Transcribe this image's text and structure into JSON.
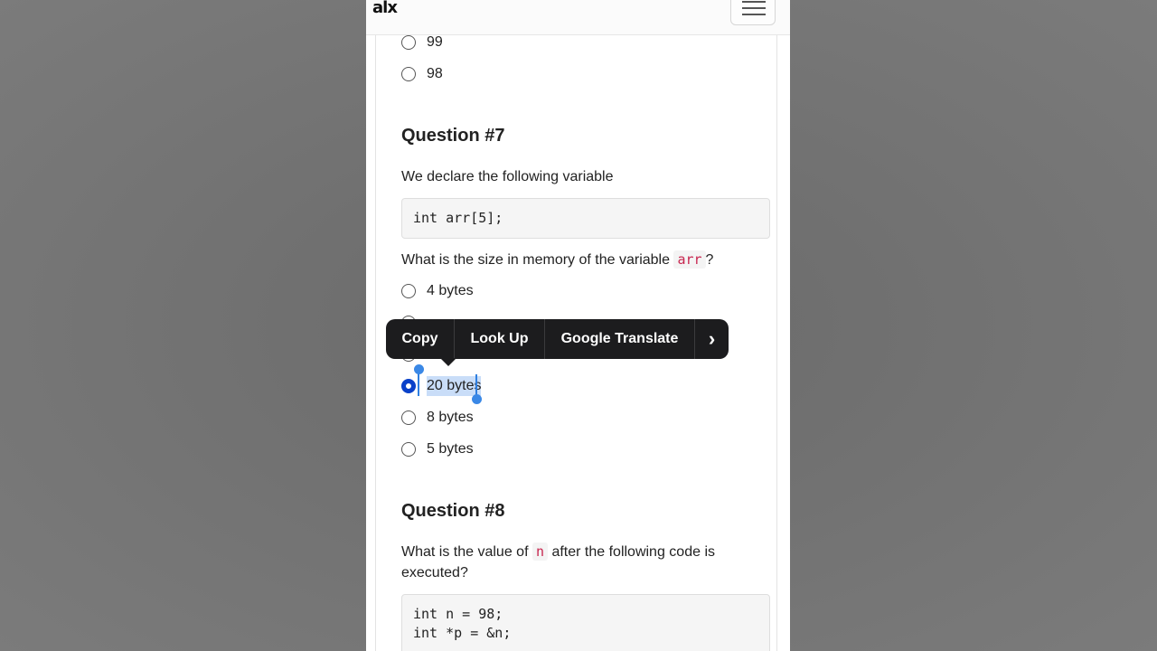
{
  "header": {
    "logo": "alx"
  },
  "prev_options": [
    {
      "label": "99"
    },
    {
      "label": "98"
    }
  ],
  "q7": {
    "title": "Question #7",
    "intro": "We declare the following variable",
    "code": "int arr[5];",
    "prompt_before": "What is the size in memory of the variable ",
    "prompt_code": "arr",
    "prompt_after": "?",
    "options": [
      {
        "label": "4 bytes",
        "checked": false
      },
      {
        "label": "20 bytes",
        "checked": true
      },
      {
        "label": "8 bytes",
        "checked": false
      },
      {
        "label": "5 bytes",
        "checked": false
      }
    ]
  },
  "q8": {
    "title": "Question #8",
    "prompt_before": "What is the value of ",
    "prompt_code": "n",
    "prompt_after": " after the following code is executed?",
    "code_line1": "int n = 98;",
    "code_line2": "int *p = &n;"
  },
  "context_menu": {
    "copy": "Copy",
    "lookup": "Look Up",
    "translate": "Google Translate",
    "more": "›"
  },
  "colors": {
    "accent": "#0a41c9",
    "selection": "#c9ddf8",
    "handle": "#3a88e6",
    "menu_bg": "#1c1c1e"
  }
}
